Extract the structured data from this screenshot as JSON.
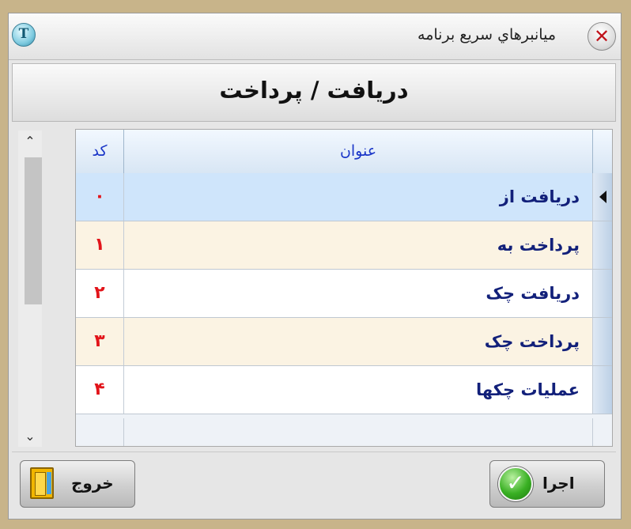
{
  "window": {
    "title": "ميانبرهاي سريع برنامه",
    "close_symbol": "✕"
  },
  "header": {
    "title": "دریافت / پرداخت"
  },
  "grid": {
    "columns": [
      "کد",
      "عنوان"
    ],
    "rows": [
      {
        "code": "۰",
        "title": "دریافت از"
      },
      {
        "code": "۱",
        "title": "پرداخت به"
      },
      {
        "code": "۲",
        "title": "دریافت چک"
      },
      {
        "code": "۳",
        "title": "پرداخت چک"
      },
      {
        "code": "۴",
        "title": "عملیات چکها"
      }
    ],
    "selected_row": 0
  },
  "scrollbar": {
    "up_symbol": "⌃",
    "down_symbol": "⌄"
  },
  "buttons": {
    "exit_label": "خروج",
    "run_label": "اجرا"
  },
  "icons": {
    "app": "app-logo-icon",
    "close": "close-icon",
    "exit": "door-exit-icon",
    "run": "green-check-icon",
    "row_pointer": "row-pointer-icon"
  },
  "colors": {
    "code_text": "#e2141a",
    "title_text": "#12207a",
    "header_text": "#1a36c8",
    "selected_row": "#cfe5fb",
    "alt_row": "#fbf3e3"
  }
}
